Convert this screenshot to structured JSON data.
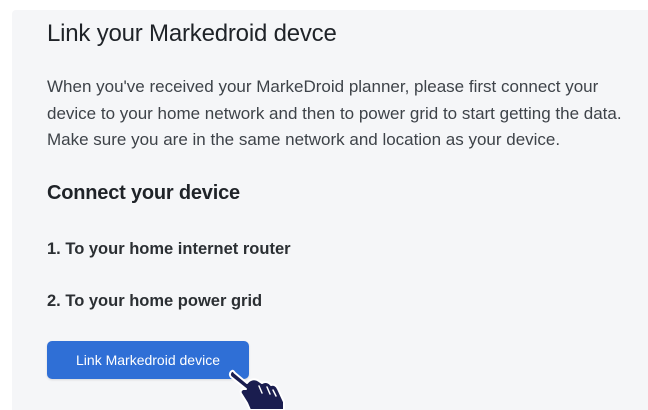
{
  "page": {
    "title": "Link your Markedroid devce",
    "intro": "When you've received your MarkeDroid planner, please first connect your device to your home network and then to power grid to start getting the data. Make sure you are in the same network and location as your device.",
    "subtitle": "Connect your device",
    "steps": [
      "1. To your home internet router",
      "2. To your home power grid"
    ],
    "link_button_label": "Link Markedroid device"
  },
  "colors": {
    "page_background": "#f5f6f8",
    "button_background": "#2f6fd6",
    "button_text": "#ffffff",
    "cursor": "#1a1d4f"
  },
  "icons": {
    "cursor": "hand-pointer-icon"
  }
}
